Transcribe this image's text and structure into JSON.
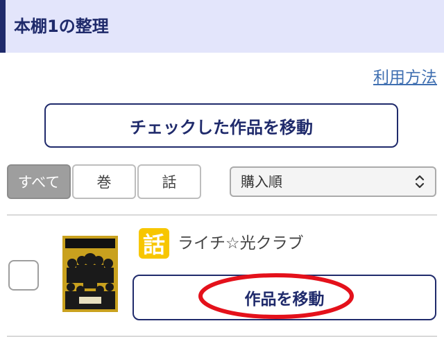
{
  "header": {
    "title": "本棚1の整理"
  },
  "usage_link": "利用方法",
  "move_checked_button": "チェックした作品を移動",
  "filters": [
    {
      "label": "すべて",
      "active": true
    },
    {
      "label": "巻",
      "active": false
    },
    {
      "label": "話",
      "active": false
    }
  ],
  "sort": {
    "selected": "購入順"
  },
  "items": [
    {
      "badge": "話",
      "title": "ライチ☆光クラブ",
      "move_label": "作品を移動",
      "cover_text": "ライチ☆光クラブ",
      "checked": false
    }
  ],
  "colors": {
    "navy": "#1f2a6b",
    "header_bg": "#e3e5fb",
    "badge": "#f7c600",
    "highlight": "#e4111b",
    "link": "#3f6fb1"
  }
}
